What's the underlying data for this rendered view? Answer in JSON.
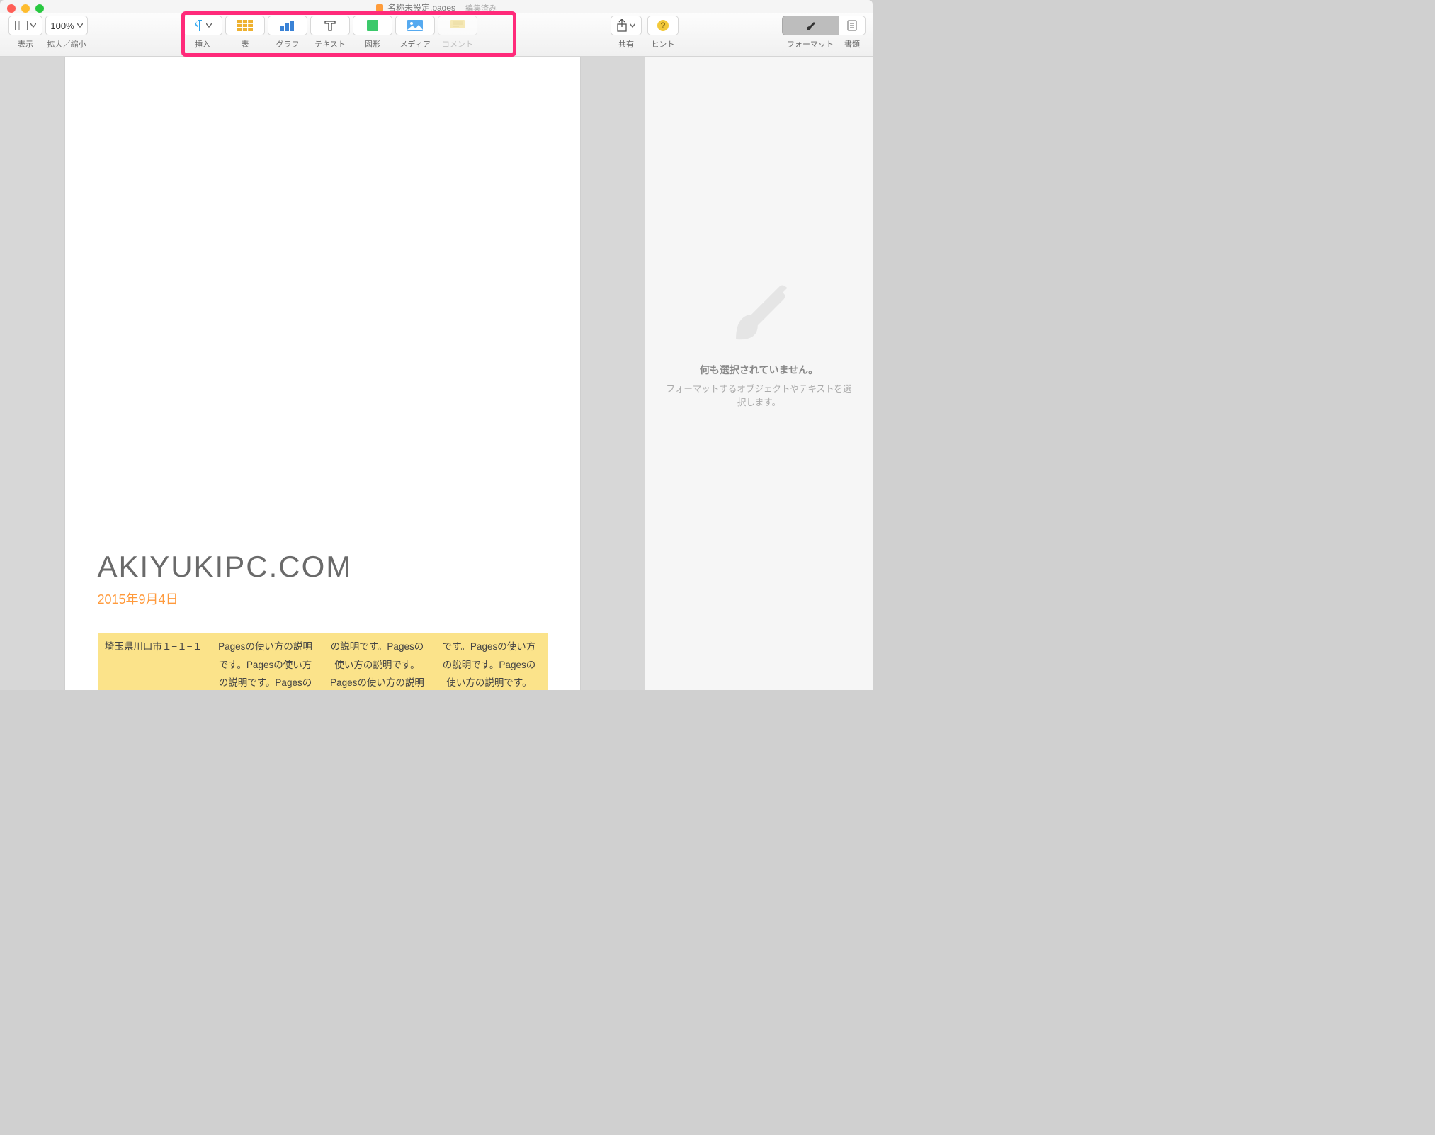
{
  "window": {
    "title": "名称未設定.pages",
    "edited": "編集済み"
  },
  "toolbar": {
    "view": "表示",
    "zoom_value": "100%",
    "zoom_label": "拡大／縮小",
    "insert": "挿入",
    "table": "表",
    "chart": "グラフ",
    "text": "テキスト",
    "shape": "図形",
    "media": "メディア",
    "comment": "コメント",
    "share": "共有",
    "hint": "ヒント"
  },
  "sidebar_tabs": {
    "format": "フォーマット",
    "document": "書類"
  },
  "sidebar": {
    "empty_title": "何も選択されていません。",
    "empty_sub": "フォーマットするオブジェクトやテキストを選択します。"
  },
  "document": {
    "title": "AKIYUKIPC.COM",
    "date": "2015年9月4日",
    "col1": "埼玉県川口市１−１−１",
    "col2": "Pagesの使い方の説明です。Pagesの使い方の説明です。Pagesの使い方の説明です。",
    "col3": "の説明です。Pagesの使い方の説明です。Pagesの使い方の説明です。Pagesの使い方",
    "col4": "です。Pagesの使い方の説明です。Pagesの使い方の説明です。Pagesの使い方の説明"
  }
}
